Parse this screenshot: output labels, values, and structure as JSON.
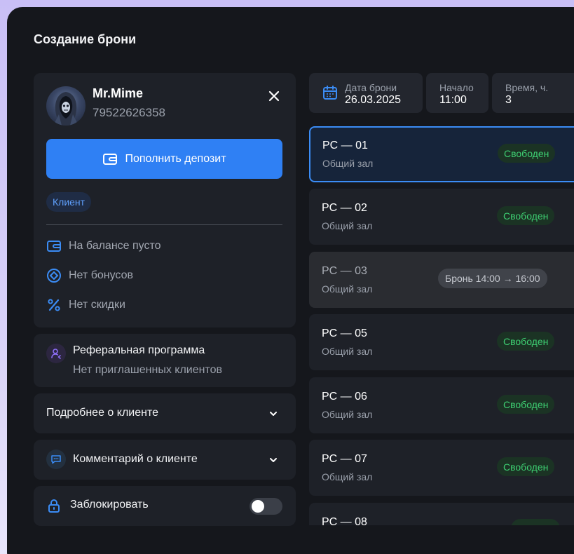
{
  "title": "Создание брони",
  "client": {
    "name": "Mr.Mime",
    "phone": "79522626358",
    "deposit_button": "Пополнить депозит",
    "role_badge": "Клиент",
    "stats": {
      "balance": "На балансе пусто",
      "bonuses": "Нет бонусов",
      "discount": "Нет скидки"
    }
  },
  "referral": {
    "title": "Реферальная программа",
    "subtitle": "Нет приглашенных клиентов"
  },
  "details": {
    "label": "Подробнее о клиенте"
  },
  "comment": {
    "label": "Комментарий о клиенте"
  },
  "block": {
    "label": "Заблокировать",
    "enabled": false
  },
  "filters": {
    "date": {
      "label": "Дата брони",
      "value": "26.03.2025"
    },
    "start": {
      "label": "Начало",
      "value": "11:00"
    },
    "duration": {
      "label": "Время, ч.",
      "value": "3"
    }
  },
  "pcs": [
    {
      "name": "PC — 01",
      "zone": "Общий зал",
      "status": "Свободен",
      "state": "selected"
    },
    {
      "name": "PC — 02",
      "zone": "Общий зал",
      "status": "Свободен",
      "state": "free"
    },
    {
      "name": "PC — 03",
      "zone": "Общий зал",
      "status": "Бронь 14:00 → 16:00",
      "state": "busy"
    },
    {
      "name": "PC — 05",
      "zone": "Общий зал",
      "status": "Свободен",
      "state": "free"
    },
    {
      "name": "PC — 06",
      "zone": "Общий зал",
      "status": "Свободен",
      "state": "free"
    },
    {
      "name": "PC — 07",
      "zone": "Общий зал",
      "status": "Свободен",
      "state": "free"
    },
    {
      "name": "PC — 08",
      "zone": "",
      "status": "",
      "state": "free"
    }
  ],
  "colors": {
    "accent": "#2f80f4",
    "free": "#3ecf72",
    "panel": "#1e2128",
    "background": "#15171c"
  }
}
